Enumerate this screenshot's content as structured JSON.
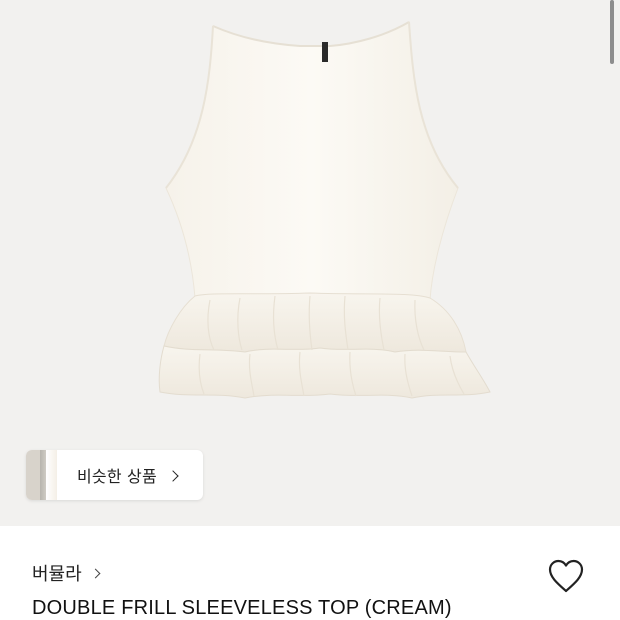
{
  "product_image": {
    "alt": "",
    "icon": "product-photo"
  },
  "similar_products": {
    "label": "비슷한 상품",
    "icon": "chevron-right-icon"
  },
  "brand": {
    "name": "버뮬라",
    "icon": "chevron-right-icon"
  },
  "wishlist": {
    "icon": "heart-outline-icon"
  },
  "product": {
    "title": "DOUBLE FRILL SLEEVELESS TOP (CREAM)"
  },
  "colors": {
    "hero_background": "#f2f1ef",
    "garment": "#fbf8f1"
  }
}
